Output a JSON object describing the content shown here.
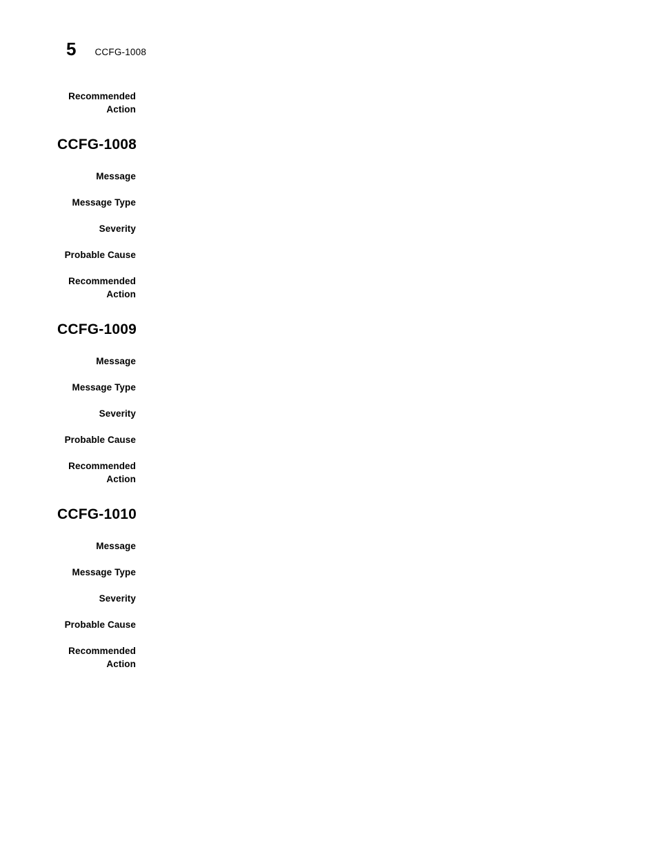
{
  "header": {
    "page_number": "5",
    "title": "CCFG-1008"
  },
  "labels": {
    "message": "Message",
    "message_type": "Message Type",
    "severity": "Severity",
    "probable_cause": "Probable Cause",
    "recommended_action": "Recommended\nAction"
  },
  "continued_block": {
    "recommended_action_label": "Recommended\nAction",
    "recommended_action_value": ""
  },
  "sections": [
    {
      "heading": "CCFG-1008",
      "rows": [
        {
          "label": "Message",
          "value": ""
        },
        {
          "label": "Message Type",
          "value": ""
        },
        {
          "label": "Severity",
          "value": ""
        },
        {
          "label": "Probable Cause",
          "value": ""
        },
        {
          "label": "Recommended\nAction",
          "value": ""
        }
      ]
    },
    {
      "heading": "CCFG-1009",
      "rows": [
        {
          "label": "Message",
          "value": ""
        },
        {
          "label": "Message Type",
          "value": ""
        },
        {
          "label": "Severity",
          "value": ""
        },
        {
          "label": "Probable Cause",
          "value": ""
        },
        {
          "label": "Recommended\nAction",
          "value": ""
        }
      ]
    },
    {
      "heading": "CCFG-1010",
      "rows": [
        {
          "label": "Message",
          "value": ""
        },
        {
          "label": "Message Type",
          "value": ""
        },
        {
          "label": "Severity",
          "value": ""
        },
        {
          "label": "Probable Cause",
          "value": ""
        },
        {
          "label": "Recommended\nAction",
          "value": ""
        }
      ]
    }
  ]
}
